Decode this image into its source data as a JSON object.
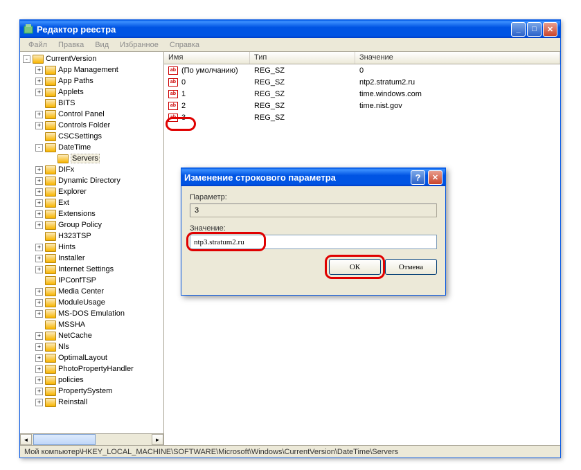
{
  "window": {
    "title": "Редактор реестра"
  },
  "menu": {
    "file": "Файл",
    "edit": "Правка",
    "view": "Вид",
    "favorites": "Избранное",
    "help": "Справка"
  },
  "tree": {
    "items": [
      {
        "indent": 0,
        "exp": "-",
        "label": "CurrentVersion",
        "selected": false
      },
      {
        "indent": 1,
        "exp": "+",
        "label": "App Management"
      },
      {
        "indent": 1,
        "exp": "+",
        "label": "App Paths"
      },
      {
        "indent": 1,
        "exp": "+",
        "label": "Applets"
      },
      {
        "indent": 1,
        "exp": "",
        "label": "BITS"
      },
      {
        "indent": 1,
        "exp": "+",
        "label": "Control Panel"
      },
      {
        "indent": 1,
        "exp": "+",
        "label": "Controls Folder"
      },
      {
        "indent": 1,
        "exp": "",
        "label": "CSCSettings"
      },
      {
        "indent": 1,
        "exp": "-",
        "label": "DateTime"
      },
      {
        "indent": 2,
        "exp": "",
        "label": "Servers",
        "selected": true
      },
      {
        "indent": 1,
        "exp": "+",
        "label": "DIFx"
      },
      {
        "indent": 1,
        "exp": "+",
        "label": "Dynamic Directory"
      },
      {
        "indent": 1,
        "exp": "+",
        "label": "Explorer"
      },
      {
        "indent": 1,
        "exp": "+",
        "label": "Ext"
      },
      {
        "indent": 1,
        "exp": "+",
        "label": "Extensions"
      },
      {
        "indent": 1,
        "exp": "+",
        "label": "Group Policy"
      },
      {
        "indent": 1,
        "exp": "",
        "label": "H323TSP"
      },
      {
        "indent": 1,
        "exp": "+",
        "label": "Hints"
      },
      {
        "indent": 1,
        "exp": "+",
        "label": "Installer"
      },
      {
        "indent": 1,
        "exp": "+",
        "label": "Internet Settings"
      },
      {
        "indent": 1,
        "exp": "",
        "label": "IPConfTSP"
      },
      {
        "indent": 1,
        "exp": "+",
        "label": "Media Center"
      },
      {
        "indent": 1,
        "exp": "+",
        "label": "ModuleUsage"
      },
      {
        "indent": 1,
        "exp": "+",
        "label": "MS-DOS Emulation"
      },
      {
        "indent": 1,
        "exp": "",
        "label": "MSSHA"
      },
      {
        "indent": 1,
        "exp": "+",
        "label": "NetCache"
      },
      {
        "indent": 1,
        "exp": "+",
        "label": "Nls"
      },
      {
        "indent": 1,
        "exp": "+",
        "label": "OptimalLayout"
      },
      {
        "indent": 1,
        "exp": "+",
        "label": "PhotoPropertyHandler"
      },
      {
        "indent": 1,
        "exp": "+",
        "label": "policies"
      },
      {
        "indent": 1,
        "exp": "+",
        "label": "PropertySystem"
      },
      {
        "indent": 1,
        "exp": "+",
        "label": "Reinstall"
      }
    ]
  },
  "list": {
    "headers": {
      "name": "Имя",
      "type": "Тип",
      "value": "Значение"
    },
    "rows": [
      {
        "name": "(По умолчанию)",
        "type": "REG_SZ",
        "value": "0"
      },
      {
        "name": "0",
        "type": "REG_SZ",
        "value": "ntp2.stratum2.ru"
      },
      {
        "name": "1",
        "type": "REG_SZ",
        "value": "time.windows.com"
      },
      {
        "name": "2",
        "type": "REG_SZ",
        "value": "time.nist.gov"
      },
      {
        "name": "3",
        "type": "REG_SZ",
        "value": ""
      }
    ]
  },
  "dialog": {
    "title": "Изменение строкового параметра",
    "param_label": "Параметр:",
    "param_value": "3",
    "value_label": "Значение:",
    "value_input": "ntp3.stratum2.ru",
    "ok": "ОК",
    "cancel": "Отмена"
  },
  "statusbar": "Мой компьютер\\HKEY_LOCAL_MACHINE\\SOFTWARE\\Microsoft\\Windows\\CurrentVersion\\DateTime\\Servers"
}
